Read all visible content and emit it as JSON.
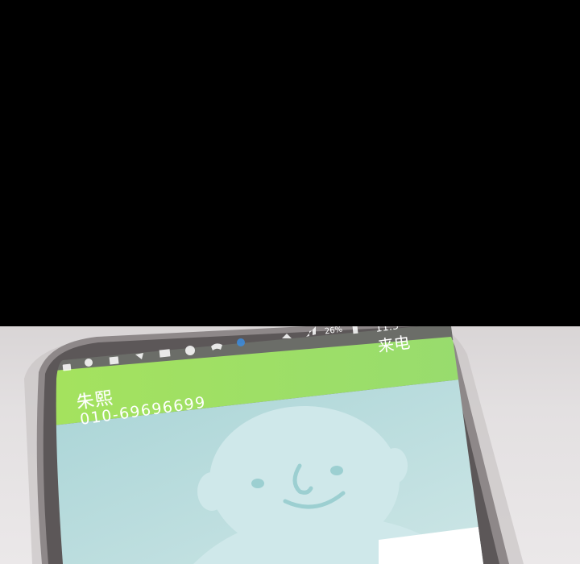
{
  "status_bar": {
    "battery": "26%",
    "time": "11:5",
    "notification_icons": [
      "notification-icon",
      "alarm-icon",
      "message-icon",
      "missed-call-icon",
      "mail-icon",
      "game-icon",
      "call-icon",
      "cloud-icon"
    ],
    "status_icons": [
      "wifi-icon",
      "signal-icon",
      "battery-icon"
    ]
  },
  "call": {
    "label": "来电",
    "caller_name": "朱熙",
    "caller_number": "010-69696699"
  },
  "colors": {
    "header_green": "#9ede62",
    "avatar_bg": "#b9dcde",
    "phone_frame": "#8a8485",
    "table": "#e3e0e1"
  }
}
